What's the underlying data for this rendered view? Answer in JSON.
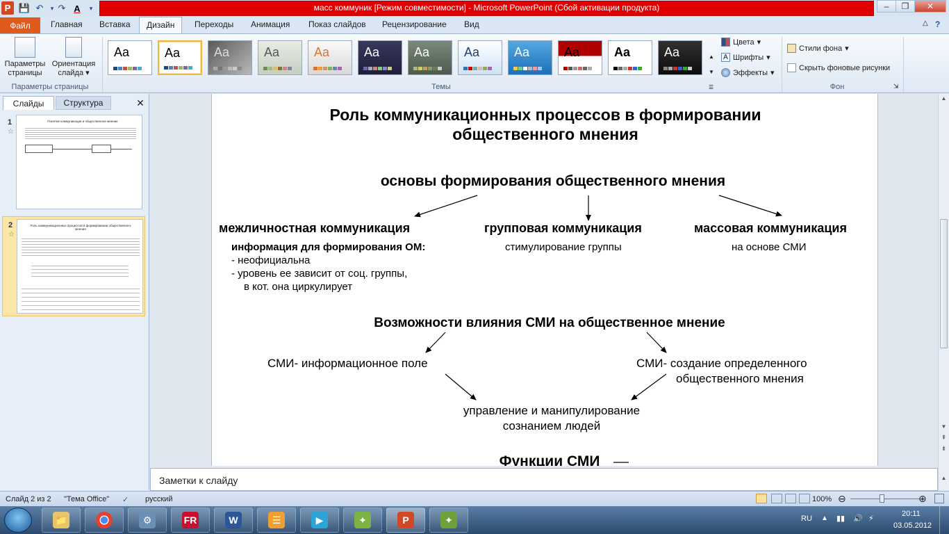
{
  "window": {
    "title": "масс коммуник [Режим совместимости] - Microsoft PowerPoint (Сбой активации продукта)",
    "app_icon_letter": "P",
    "font_color_letter": "A"
  },
  "tabs": {
    "file": "Файл",
    "items": [
      "Главная",
      "Вставка",
      "Дизайн",
      "Переходы",
      "Анимация",
      "Показ слайдов",
      "Рецензирование",
      "Вид"
    ],
    "active": "Дизайн"
  },
  "ribbon": {
    "page_setup": {
      "params_label": "Параметры страницы",
      "orientation_label": "Ориентация слайда",
      "group_label": "Параметры страницы"
    },
    "themes": {
      "group_label": "Темы",
      "sample": "Aa"
    },
    "theme_options": {
      "colors": "Цвета",
      "fonts": "Шрифты",
      "effects": "Эффекты"
    },
    "background": {
      "styles": "Стили фона",
      "hide_graphics": "Скрыть фоновые рисунки",
      "group_label": "Фон"
    }
  },
  "left_pane": {
    "tab_slides": "Слайды",
    "tab_outline": "Структура",
    "slides": [
      {
        "num": "1",
        "title": "Понятие коммуникации и общественное мнение"
      },
      {
        "num": "2",
        "title": "Роль коммуникационных процессов в формировании общественного мнения"
      }
    ]
  },
  "slide": {
    "title_line1": "Роль коммуникационных процессов в формировании",
    "title_line2": "общественного мнения",
    "subtitle": "основы формирования общественного мнения",
    "branch1": "межличностная коммуникация",
    "branch2": "групповая коммуникация",
    "branch3": "массовая коммуникация",
    "info_head": "информация для формирования ОМ:",
    "info_items": [
      "- неофициальна",
      "- уровень ее зависит от соц. группы,",
      "в кот. она циркулирует"
    ],
    "group_note": "стимулирование группы",
    "mass_note": "на основе СМИ",
    "section2": "Возможности влияния СМИ на общественное мнение",
    "smi_left": "СМИ- информационное поле",
    "smi_right_1": "СМИ- создание определенного",
    "smi_right_2": "общественного мнения",
    "manip_1": "управление и манипулирование",
    "manip_2": "сознанием людей",
    "section3": "Функции СМИ"
  },
  "notes": {
    "placeholder": "Заметки к слайду"
  },
  "status": {
    "slide_info": "Слайд 2 из 2",
    "theme": "\"Тема Office\"",
    "language": "русский",
    "zoom": "100%"
  },
  "tray": {
    "lang": "RU",
    "time": "20:11",
    "date": "03.05.2012"
  },
  "colors": {
    "title_red": "#e00000",
    "file_tab": "#e05a1c"
  }
}
